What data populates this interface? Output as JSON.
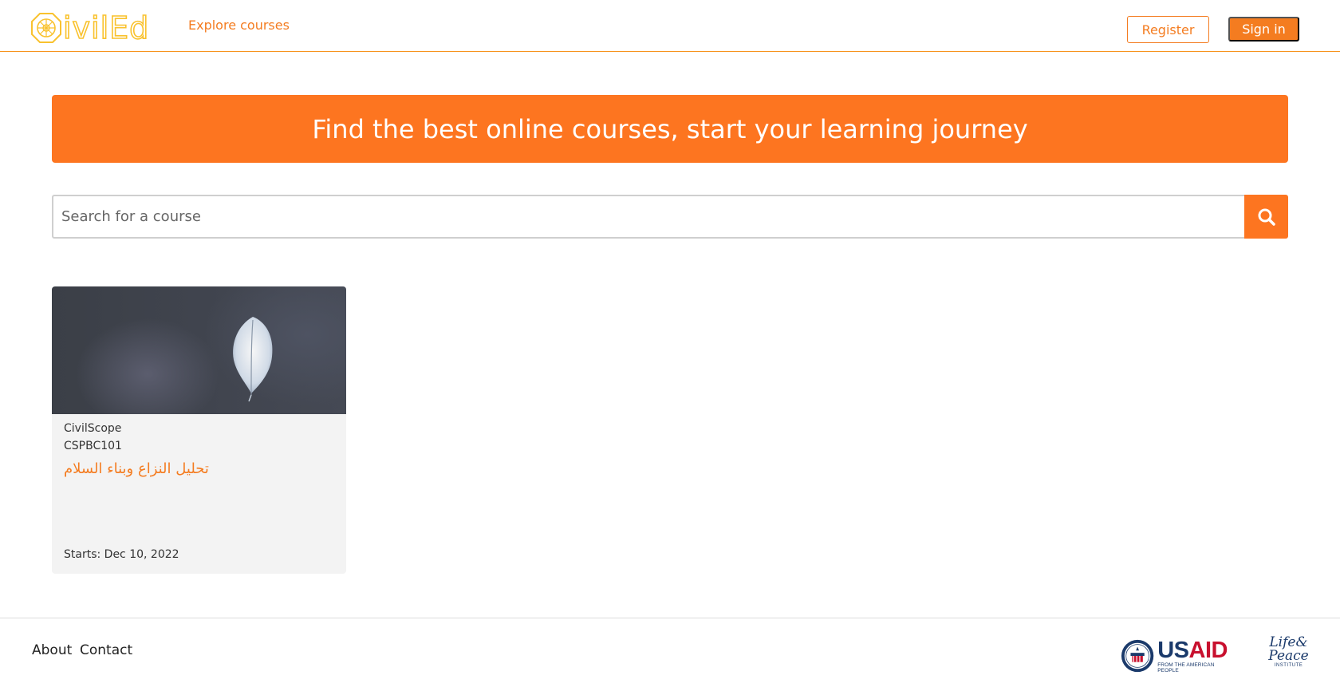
{
  "header": {
    "logo_text": "ivilEd",
    "explore_label": "Explore courses",
    "register_label": "Register",
    "signin_label": "Sign in"
  },
  "hero": {
    "title": "Find the best online courses, start your learning journey"
  },
  "search": {
    "placeholder": "Search for a course",
    "value": ""
  },
  "courses": [
    {
      "org": "CivilScope",
      "code": "CSPBC101",
      "title": "تحليل النزاع وبناء السلام",
      "start": "Starts: Dec 10, 2022"
    }
  ],
  "footer": {
    "about_label": "About",
    "contact_label": "Contact",
    "usaid_word_us": "US",
    "usaid_word_aid": "AID",
    "usaid_tagline": "FROM THE AMERICAN PEOPLE",
    "lpi_line1": "Life&",
    "lpi_line2": "Peace",
    "lpi_tagline": "INSTITUTE"
  },
  "colors": {
    "accent": "#f47c20",
    "hero_bg": "#fd7520",
    "logo": "#f9c22e",
    "card_bg": "#f3f3f3"
  }
}
